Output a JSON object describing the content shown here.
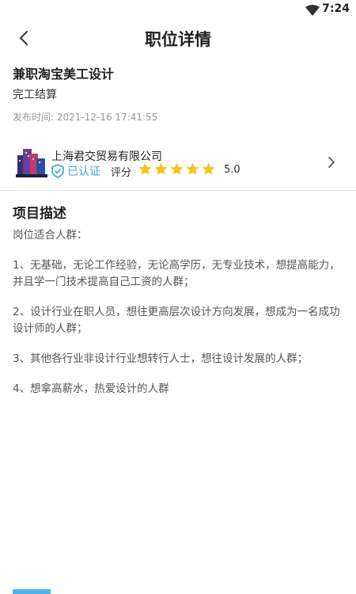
{
  "status_bar": {
    "time": "7:24",
    "wifi_icon": "wifi-icon"
  },
  "header": {
    "title": "职位详情",
    "back_icon": "chevron-left-icon"
  },
  "job": {
    "title": "兼职淘宝美工设计",
    "settlement": "完工结算",
    "publish_label": "发布时间:",
    "publish_time": "2021-12-16 17:41:55"
  },
  "company": {
    "name": "上海君交贸易有限公司",
    "verified_label": "已认证",
    "rating_label": "评分",
    "rating_value": "5.0",
    "stars_filled": 5,
    "stars_total": 5,
    "colors": {
      "verified": "#3aa3e3",
      "star": "#f5c518"
    }
  },
  "project": {
    "section_title": "项目描述",
    "paragraphs": [
      "岗位适合人群：",
      "1、无基础，无论工作经验，无论高学历，无专业技术，想提高能力，并且学一门技术提高自己工资的人群；",
      "2、设计行业在职人员，想往更高层次设计方向发展，想成为一名成功设计师的人群；",
      "3、其他各行业非设计行业想转行人士，想往设计发展的人群；",
      "4、想拿高薪水，热爱设计的人群"
    ]
  }
}
